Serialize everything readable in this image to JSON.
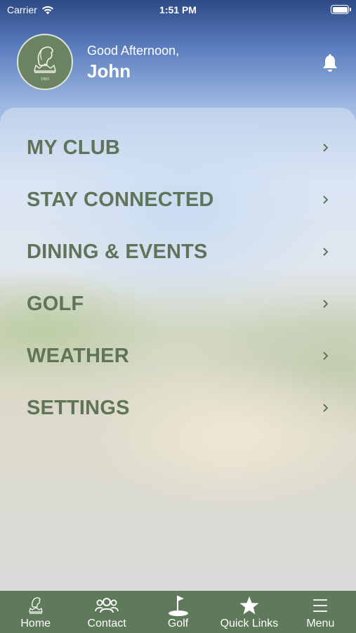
{
  "status_bar": {
    "carrier": "Carrier",
    "time": "1:51 PM"
  },
  "header": {
    "greeting": "Good Afternoon,",
    "user_name": "John",
    "logo_year": "1893"
  },
  "menu": {
    "items": [
      {
        "label": "MY CLUB"
      },
      {
        "label": "STAY CONNECTED"
      },
      {
        "label": "DINING & EVENTS"
      },
      {
        "label": "GOLF"
      },
      {
        "label": "WEATHER"
      },
      {
        "label": "SETTINGS"
      }
    ]
  },
  "tab_bar": {
    "tabs": [
      {
        "label": "Home",
        "icon": "club-logo-icon"
      },
      {
        "label": "Contact",
        "icon": "people-icon"
      },
      {
        "label": "Golf",
        "icon": "golf-flag-icon"
      },
      {
        "label": "Quick Links",
        "icon": "star-icon"
      },
      {
        "label": "Menu",
        "icon": "hamburger-icon"
      }
    ]
  },
  "colors": {
    "accent": "#5f7458",
    "tab_bar": "#5f7a5a"
  }
}
